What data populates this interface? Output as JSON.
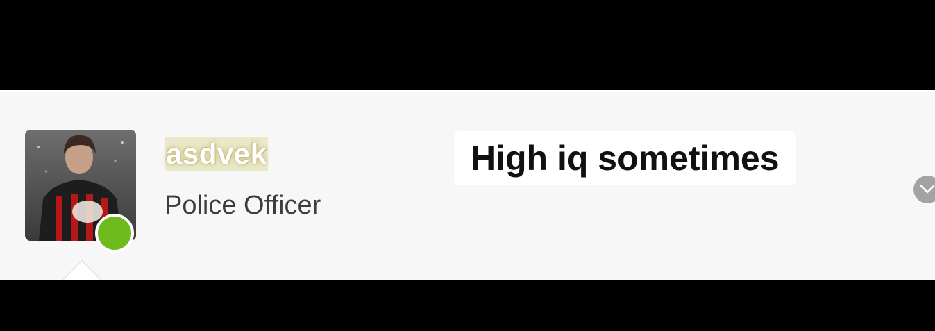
{
  "profile": {
    "username": "asdvek",
    "role": "Police Officer",
    "status": "online",
    "status_color": "#6dbb1c",
    "avatar_icon": "profile-photo"
  },
  "caption": {
    "text": "High iq sometimes"
  },
  "controls": {
    "expand_icon": "chevron-down-icon"
  }
}
